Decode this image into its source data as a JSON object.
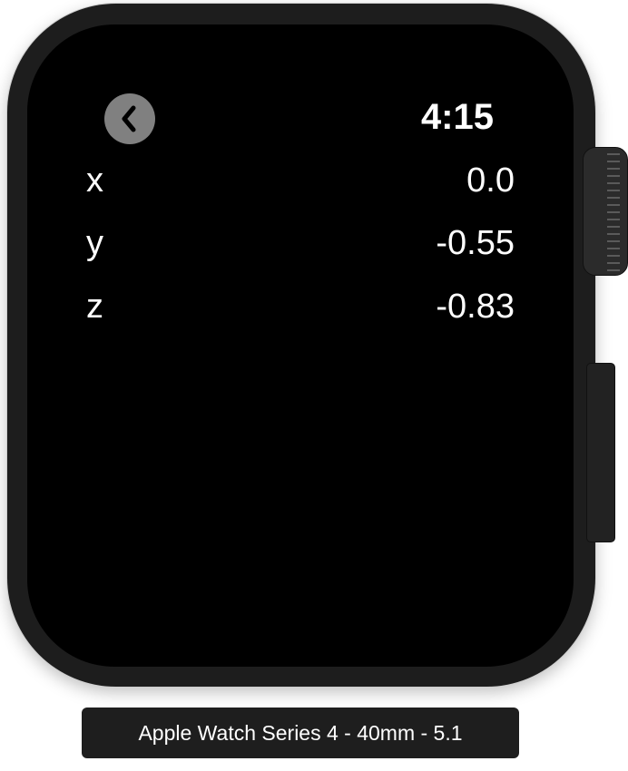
{
  "watch": {
    "time": "4:15",
    "back_icon": "chevron-left-icon",
    "rows": [
      {
        "axis": "x",
        "value": "0.0"
      },
      {
        "axis": "y",
        "value": "-0.55"
      },
      {
        "axis": "z",
        "value": "-0.83"
      }
    ]
  },
  "device_label": "Apple Watch Series 4 - 40mm - 5.1"
}
